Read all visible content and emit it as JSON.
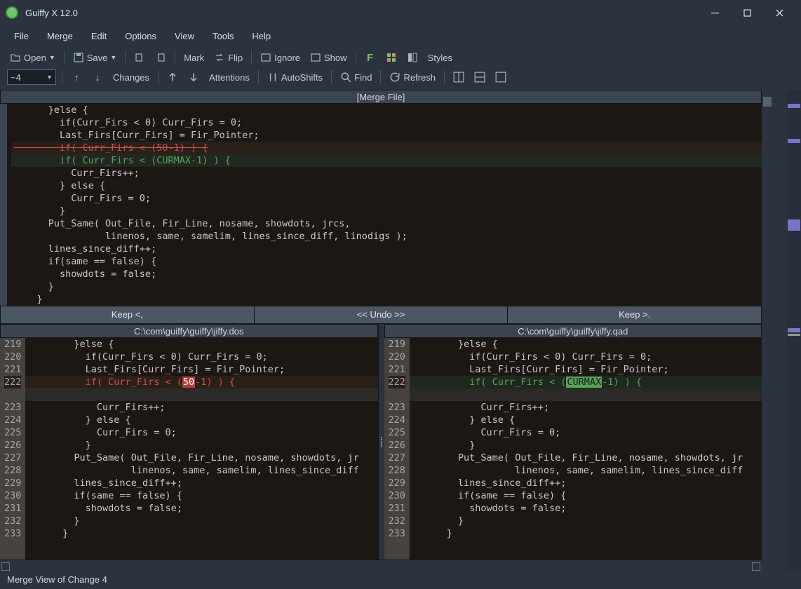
{
  "window": {
    "title": "Guiffy X 12.0"
  },
  "menu": [
    "File",
    "Merge",
    "Edit",
    "Options",
    "View",
    "Tools",
    "Help"
  ],
  "toolbar": {
    "open": "Open",
    "save": "Save",
    "mark": "Mark",
    "flip": "Flip",
    "ignore": "Ignore",
    "show": "Show",
    "styles": "Styles"
  },
  "toolbar2": {
    "combo_value": "~4",
    "changes": "Changes",
    "attentions": "Attentions",
    "autoshifts": "AutoShifts",
    "find": "Find",
    "refresh": "Refresh"
  },
  "merge": {
    "title": "[Merge File]",
    "lines": [
      {
        "t": "      }else {",
        "c": ""
      },
      {
        "t": "        if(Curr_Firs < 0) Curr_Firs = 0;",
        "c": ""
      },
      {
        "t": "        Last_Firs[Curr_Firs] = Fir_Pointer;",
        "c": ""
      },
      {
        "t": "        if( Curr_Firs < (50-1) ) {",
        "c": "del"
      },
      {
        "t": "        if( Curr_Firs < (CURMAX-1) ) {",
        "c": "add"
      },
      {
        "t": "          Curr_Firs++;",
        "c": ""
      },
      {
        "t": "        } else {",
        "c": ""
      },
      {
        "t": "          Curr_Firs = 0;",
        "c": ""
      },
      {
        "t": "        }",
        "c": ""
      },
      {
        "t": "      Put_Same( Out_File, Fir_Line, nosame, showdots, jrcs,",
        "c": ""
      },
      {
        "t": "                linenos, same, samelim, lines_since_diff, linodigs );",
        "c": ""
      },
      {
        "t": "      lines_since_diff++;",
        "c": ""
      },
      {
        "t": "      if(same == false) {",
        "c": ""
      },
      {
        "t": "        showdots = false;",
        "c": ""
      },
      {
        "t": "      }",
        "c": ""
      },
      {
        "t": "    }",
        "c": ""
      }
    ]
  },
  "actions": {
    "keep_left": "Keep <,",
    "undo": "<<  Undo  >>",
    "keep_right": "Keep >."
  },
  "left_file": {
    "path": "C:\\com\\guiffy\\guiffy\\jiffy.dos",
    "lines": [
      {
        "n": "219",
        "t": "        }else {"
      },
      {
        "n": "220",
        "t": "          if(Curr_Firs < 0) Curr_Firs = 0;"
      },
      {
        "n": "221",
        "t": "          Last_Firs[Curr_Firs] = Fir_Pointer;"
      },
      {
        "n": "222",
        "t": "          if( Curr_Firs < (",
        "chip": "50",
        "rest": "-1) ) {",
        "hl": "red"
      },
      {
        "n": "",
        "t": "",
        "blank": true
      },
      {
        "n": "223",
        "t": "            Curr_Firs++;"
      },
      {
        "n": "224",
        "t": "          } else {"
      },
      {
        "n": "225",
        "t": "            Curr_Firs = 0;"
      },
      {
        "n": "226",
        "t": "          }"
      },
      {
        "n": "227",
        "t": "        Put_Same( Out_File, Fir_Line, nosame, showdots, jr"
      },
      {
        "n": "228",
        "t": "                  linenos, same, samelim, lines_since_diff"
      },
      {
        "n": "229",
        "t": "        lines_since_diff++;"
      },
      {
        "n": "230",
        "t": "        if(same == false) {"
      },
      {
        "n": "231",
        "t": "          showdots = false;"
      },
      {
        "n": "232",
        "t": "        }"
      },
      {
        "n": "233",
        "t": "      }"
      }
    ]
  },
  "right_file": {
    "path": "C:\\com\\guiffy\\guiffy\\jiffy.qad",
    "lines": [
      {
        "n": "219",
        "t": "        }else {"
      },
      {
        "n": "220",
        "t": "          if(Curr_Firs < 0) Curr_Firs = 0;"
      },
      {
        "n": "221",
        "t": "          Last_Firs[Curr_Firs] = Fir_Pointer;"
      },
      {
        "n": "222",
        "t": "          if( Curr_Firs < (",
        "chip": "CURMAX",
        "rest": "-1) ) {",
        "hl": "grn"
      },
      {
        "n": "",
        "t": "",
        "blank": true
      },
      {
        "n": "223",
        "t": "            Curr_Firs++;"
      },
      {
        "n": "224",
        "t": "          } else {"
      },
      {
        "n": "225",
        "t": "            Curr_Firs = 0;"
      },
      {
        "n": "226",
        "t": "          }"
      },
      {
        "n": "227",
        "t": "        Put_Same( Out_File, Fir_Line, nosame, showdots, jr"
      },
      {
        "n": "228",
        "t": "                  linenos, same, samelim, lines_since_diff"
      },
      {
        "n": "229",
        "t": "        lines_since_diff++;"
      },
      {
        "n": "230",
        "t": "        if(same == false) {"
      },
      {
        "n": "231",
        "t": "          showdots = false;"
      },
      {
        "n": "232",
        "t": "        }"
      },
      {
        "n": "233",
        "t": "      }"
      }
    ]
  },
  "status": "Merge View of Change 4"
}
